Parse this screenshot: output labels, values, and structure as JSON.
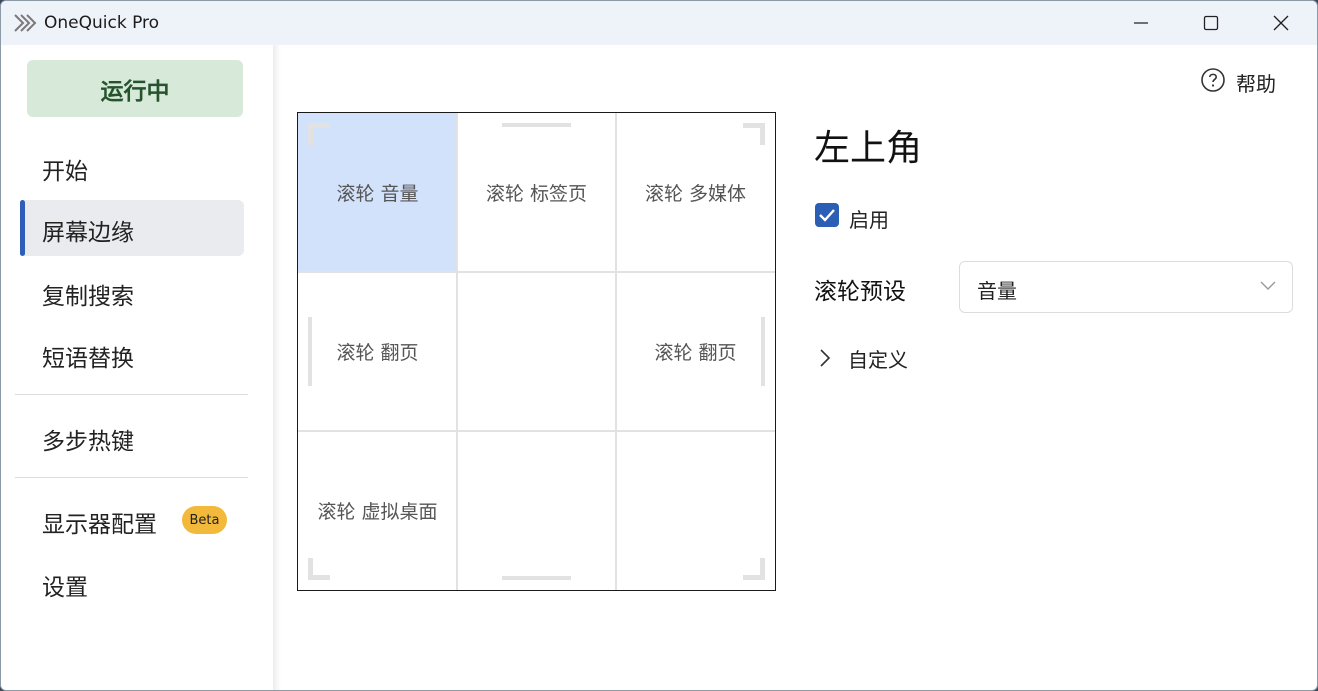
{
  "window": {
    "title": "OneQuick Pro",
    "icons": {
      "app": "app-chevrons-icon",
      "minimize": "minimize-icon",
      "maximize": "maximize-icon",
      "close": "close-icon"
    }
  },
  "sidebar": {
    "status_label": "运行中",
    "items": [
      {
        "label": "开始"
      },
      {
        "label": "屏幕边缘",
        "active": true
      },
      {
        "label": "复制搜索"
      },
      {
        "label": "短语替换"
      },
      {
        "label": "多步热键"
      },
      {
        "label": "显示器配置",
        "badge": "Beta"
      },
      {
        "label": "设置"
      }
    ]
  },
  "header": {
    "help_label": "帮助",
    "help_icon": "question-circle-icon"
  },
  "grid": {
    "cells": [
      {
        "label": "滚轮 音量",
        "selected": true
      },
      {
        "label": "滚轮 标签页"
      },
      {
        "label": "滚轮 多媒体"
      },
      {
        "label": "滚轮 翻页"
      },
      {
        "label": ""
      },
      {
        "label": "滚轮 翻页"
      },
      {
        "label": "滚轮 虚拟桌面"
      },
      {
        "label": ""
      },
      {
        "label": ""
      }
    ]
  },
  "detail": {
    "title": "左上角",
    "enable_label": "启用",
    "enable_checked": true,
    "preset_label": "滚轮预设",
    "preset_value": "音量",
    "custom_label": "自定义"
  },
  "colors": {
    "accent": "#2a5fb5",
    "status_bg": "#d7ead9",
    "status_text": "#26522e",
    "selected_cell": "#d3e2fb",
    "beta_badge": "#f2b93b"
  }
}
